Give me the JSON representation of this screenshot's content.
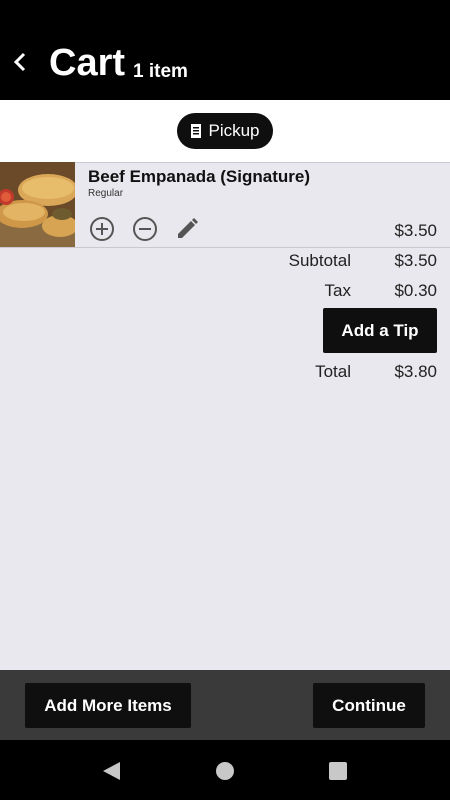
{
  "header": {
    "back_icon": "chevron-left-icon",
    "title": "Cart",
    "item_count": "1 item"
  },
  "order_mode": {
    "icon": "receipt-icon",
    "label": "Pickup"
  },
  "cart_item": {
    "image": "beef-empanada-photo",
    "name": "Beef Empanada (Signature)",
    "option": "Regular",
    "price": "$3.50",
    "actions": [
      "add-circle-icon",
      "remove-circle-icon",
      "edit-pencil-icon"
    ]
  },
  "summary": {
    "subtotal_label": "Subtotal",
    "subtotal_value": "$3.50",
    "tax_label": "Tax",
    "tax_value": "$0.30",
    "tip_button": "Add a Tip",
    "total_label": "Total",
    "total_value": "$3.80"
  },
  "footer": {
    "add_more_label": "Add More Items",
    "continue_label": "Continue"
  },
  "system_nav": [
    "back-triangle-icon",
    "home-circle-icon",
    "recents-square-icon"
  ],
  "colors": {
    "header_bg": "#000000",
    "content_bg": "#e8e8ee",
    "button_bg": "#0f0f0f",
    "bottom_bar_bg": "#3a3a3a"
  }
}
